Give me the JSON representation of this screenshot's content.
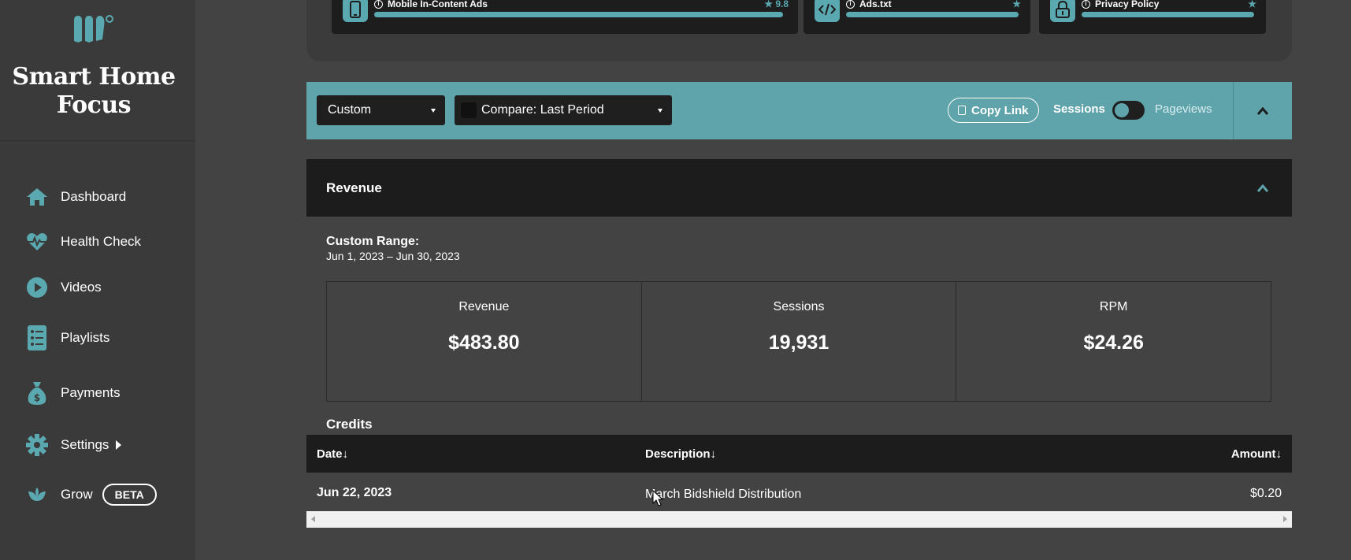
{
  "sidebar": {
    "brand": "Smart Home Focus",
    "items": [
      {
        "label": "Dashboard",
        "icon": "home-icon"
      },
      {
        "label": "Health Check",
        "icon": "heartbeat-icon"
      },
      {
        "label": "Videos",
        "icon": "play-circle-icon"
      },
      {
        "label": "Playlists",
        "icon": "list-icon"
      },
      {
        "label": "Payments",
        "icon": "money-bag-icon"
      },
      {
        "label": "Settings",
        "icon": "gear-icon"
      },
      {
        "label": "Grow",
        "icon": "leaf-icon",
        "badge": "BETA"
      }
    ]
  },
  "top_cards": [
    {
      "title": "Mobile In-Content Ads",
      "score": "9.8",
      "icon": "mobile-icon"
    },
    {
      "title": "Ads.txt",
      "icon": "code-icon"
    },
    {
      "title": "Privacy Policy",
      "icon": "lock-icon"
    }
  ],
  "filter_bar": {
    "range_select": "Custom",
    "compare_select": "Compare: Last Period",
    "copy_link": "Copy Link",
    "toggle_left": "Sessions",
    "toggle_right": "Pageviews"
  },
  "revenue": {
    "title": "Revenue",
    "range_title": "Custom Range:",
    "range_dates": "Jun 1, 2023 – Jun 30, 2023",
    "metrics": [
      {
        "label": "Revenue",
        "value": "$483.80"
      },
      {
        "label": "Sessions",
        "value": "19,931"
      },
      {
        "label": "RPM",
        "value": "$24.26"
      }
    ],
    "credits_title": "Credits",
    "columns": {
      "date": "Date",
      "description": "Description",
      "amount": "Amount"
    },
    "rows": [
      {
        "date": "Jun 22, 2023",
        "description": "March Bidshield Distribution",
        "amount": "$0.20"
      }
    ]
  },
  "colors": {
    "accent": "#5fa3ab",
    "background": "#434343",
    "sidebar": "#3a3a3a",
    "header": "#1c1c1c"
  }
}
